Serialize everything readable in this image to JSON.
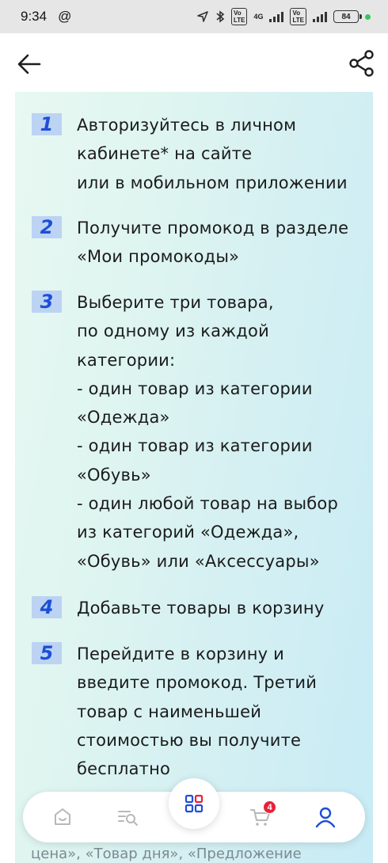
{
  "status_bar": {
    "time": "9:34",
    "at_symbol": "@",
    "network": "4G",
    "battery": "84"
  },
  "header": {
    "back_icon": "arrow-left-icon",
    "share_icon": "share-icon"
  },
  "steps": [
    {
      "number": "1",
      "text": "Авторизуйтесь в личном\nкабинете* на сайте\nили в мобильном приложении"
    },
    {
      "number": "2",
      "text": "Получите промокод в разделе\n«Мои промокоды»"
    },
    {
      "number": "3",
      "text": "Выберите три товара,\nпо одному из каждой\nкатегории:\n- один товар из категории\n«Одежда»\n- один товар из категории\n«Обувь»\n- один любой товар на выбор\nиз категорий «Одежда»,\n«Обувь» или «Аксессуары»"
    },
    {
      "number": "4",
      "text": "Добавьте товары в корзину"
    },
    {
      "number": "5",
      "text": "Перейдите в корзину и\nвведите промокод. Третий\nтовар с наименьшей\nстоимостью вы получите\nбесплатно"
    }
  ],
  "footer_partial_text": "цена», «Товар дня», «Предложение",
  "bottom_nav": {
    "items": [
      "home-icon",
      "search-list-icon",
      "catalog-grid-icon",
      "cart-icon",
      "profile-icon"
    ],
    "cart_count": "4",
    "accent_color": "#1d4fd6",
    "badge_color": "#e8213a"
  }
}
